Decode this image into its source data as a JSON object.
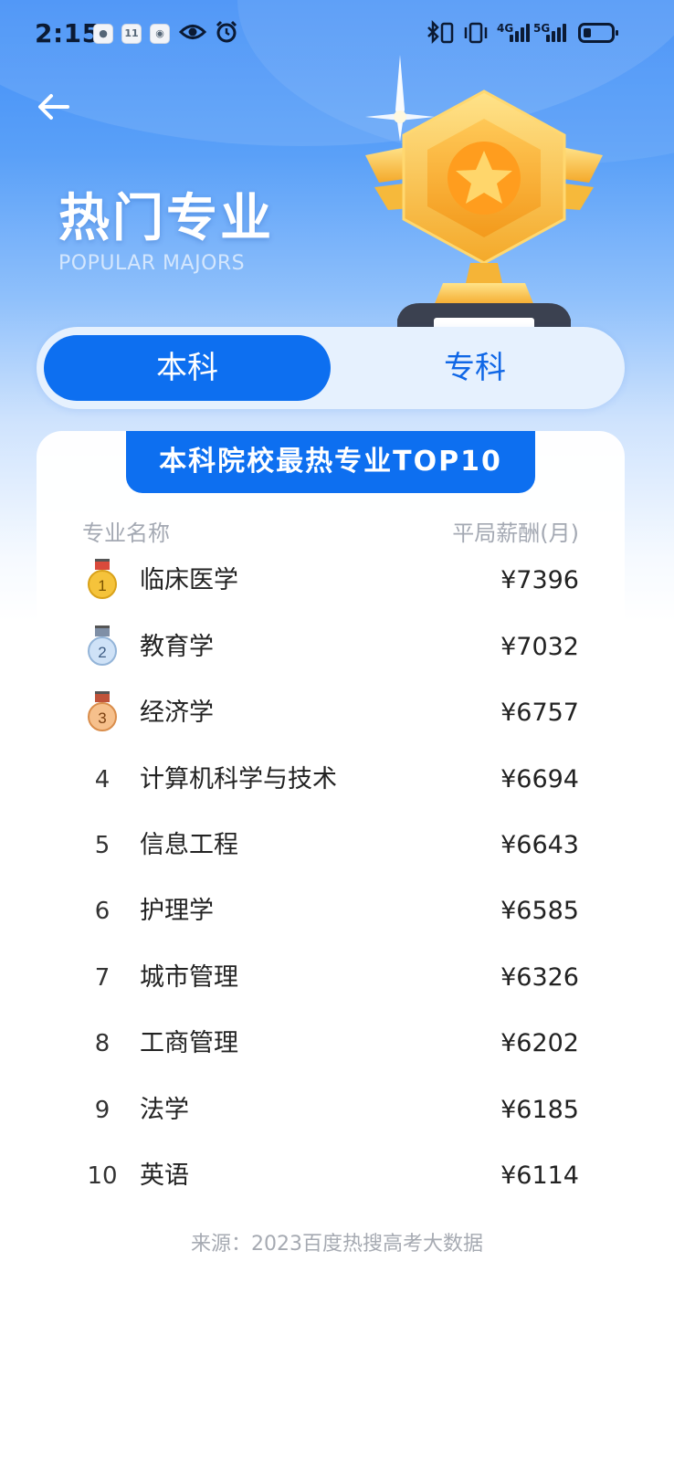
{
  "status_bar": {
    "time": "2:15",
    "network_1": "4G",
    "network_2": "5G"
  },
  "header": {
    "title": "热门专业",
    "subtitle": "POPULAR MAJORS"
  },
  "tabs": [
    {
      "label": "本科",
      "selected": true
    },
    {
      "label": "专科",
      "selected": false
    }
  ],
  "card": {
    "ribbon_title": "本科院校最热专业TOP10",
    "column_name": "专业名称",
    "column_salary": "平局薪酬(月)"
  },
  "ranking": [
    {
      "rank": "1",
      "major": "临床医学",
      "salary": "¥7396",
      "medal": "gold"
    },
    {
      "rank": "2",
      "major": "教育学",
      "salary": "¥7032",
      "medal": "silver"
    },
    {
      "rank": "3",
      "major": "经济学",
      "salary": "¥6757",
      "medal": "bronze"
    },
    {
      "rank": "4",
      "major": "计算机科学与技术",
      "salary": "¥6694"
    },
    {
      "rank": "5",
      "major": "信息工程",
      "salary": "¥6643"
    },
    {
      "rank": "6",
      "major": "护理学",
      "salary": "¥6585"
    },
    {
      "rank": "7",
      "major": "城市管理",
      "salary": "¥6326"
    },
    {
      "rank": "8",
      "major": "工商管理",
      "salary": "¥6202"
    },
    {
      "rank": "9",
      "major": "法学",
      "salary": "¥6185"
    },
    {
      "rank": "10",
      "major": "英语",
      "salary": "¥6114"
    }
  ],
  "footer": {
    "source": "来源：2023百度热搜高考大数据"
  },
  "colors": {
    "primary": "#0d6ff0",
    "gold": "#f5c33b",
    "silver": "#b9d3ef",
    "bronze": "#f2b67b"
  },
  "icons": {
    "back": "arrow-left-icon",
    "trophy": "trophy-icon",
    "eye": "eye-icon",
    "alarm": "alarm-icon",
    "bluetooth": "bluetooth-icon",
    "vibrate": "vibrate-icon",
    "battery": "battery-icon"
  }
}
